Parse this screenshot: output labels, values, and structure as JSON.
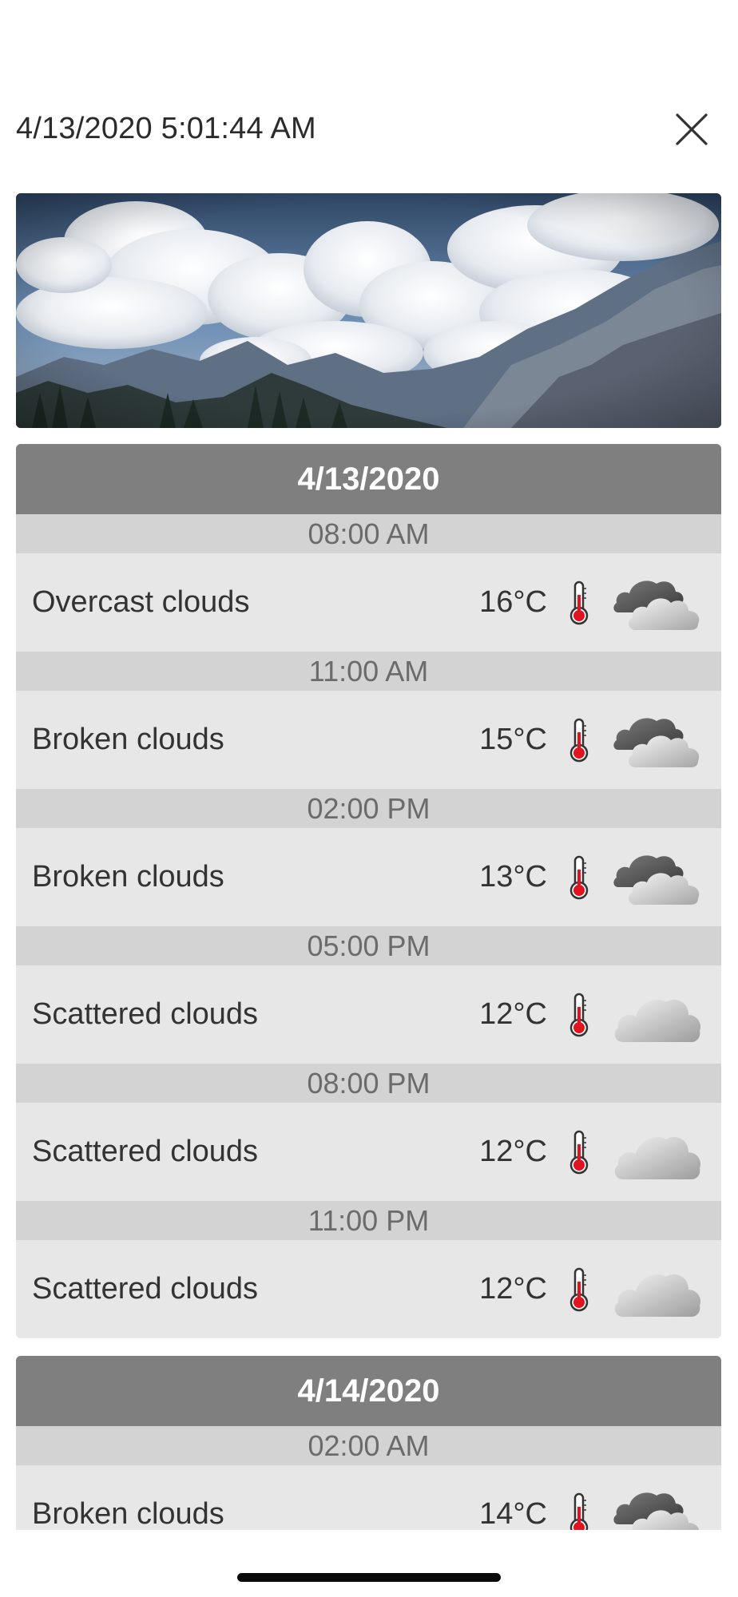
{
  "header": {
    "timestamp": "4/13/2020 5:01:44 AM"
  },
  "icons": {
    "close": "close-icon",
    "thermometer": "thermometer-icon",
    "dark_cloud": "dark-clouds-icon",
    "light_cloud": "light-cloud-icon"
  },
  "days": [
    {
      "date": "4/13/2020",
      "entries": [
        {
          "time": "08:00 AM",
          "description": "Overcast clouds",
          "temperature": "16°C",
          "icon": "dark"
        },
        {
          "time": "11:00 AM",
          "description": "Broken clouds",
          "temperature": "15°C",
          "icon": "dark"
        },
        {
          "time": "02:00 PM",
          "description": "Broken clouds",
          "temperature": "13°C",
          "icon": "dark"
        },
        {
          "time": "05:00 PM",
          "description": "Scattered clouds",
          "temperature": "12°C",
          "icon": "light"
        },
        {
          "time": "08:00 PM",
          "description": "Scattered clouds",
          "temperature": "12°C",
          "icon": "light"
        },
        {
          "time": "11:00 PM",
          "description": "Scattered clouds",
          "temperature": "12°C",
          "icon": "light"
        }
      ]
    },
    {
      "date": "4/14/2020",
      "entries": [
        {
          "time": "02:00 AM",
          "description": "Broken clouds",
          "temperature": "14°C",
          "icon": "dark"
        }
      ]
    }
  ]
}
